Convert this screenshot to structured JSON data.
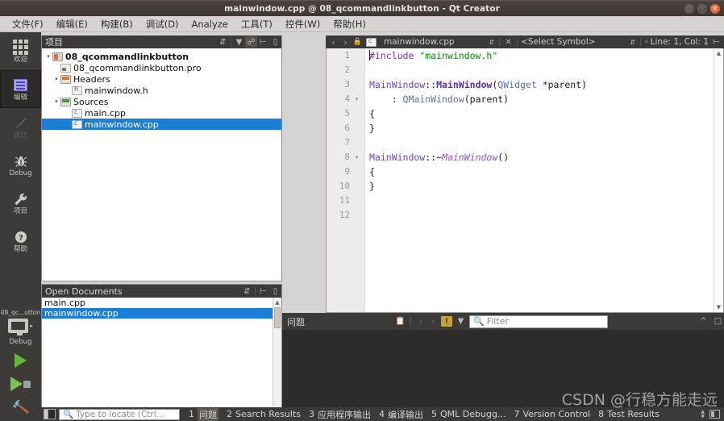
{
  "window": {
    "title": "mainwindow.cpp @ 08_qcommandlinkbutton - Qt Creator",
    "controls": {
      "minimize": "–",
      "maximize": "□",
      "close": "×"
    }
  },
  "menubar": [
    {
      "label": "文件(F)"
    },
    {
      "label": "编辑(E)"
    },
    {
      "label": "构建(B)"
    },
    {
      "label": "调试(D)"
    },
    {
      "label": "Analyze"
    },
    {
      "label": "工具(T)"
    },
    {
      "label": "控件(W)"
    },
    {
      "label": "帮助(H)"
    }
  ],
  "modebar": {
    "modes": [
      {
        "label": "欢迎",
        "icon": "grid-icon",
        "state": "normal"
      },
      {
        "label": "编辑",
        "icon": "editor-icon",
        "state": "selected"
      },
      {
        "label": "设计",
        "icon": "pencil-icon",
        "state": "disabled"
      },
      {
        "label": "Debug",
        "icon": "bug-icon",
        "state": "normal"
      },
      {
        "label": "项目",
        "icon": "wrench-icon",
        "state": "normal"
      },
      {
        "label": "帮助",
        "icon": "question-icon",
        "state": "normal"
      }
    ],
    "kit": {
      "project": "08_qc...utton",
      "build_config": "Debug",
      "run_label": "run-icon",
      "debug_label": "debug-run-icon",
      "build_label": "build-hammer-icon"
    }
  },
  "project_panel": {
    "title": "项目",
    "toolbar": [
      "sync-selector-icon",
      "filter-icon",
      "link-with-editor-icon",
      "split-icon",
      "close-icon"
    ],
    "tree": [
      {
        "label": "08_qcommandlinkbutton",
        "indent": 0,
        "arrow": "▾",
        "icon": "project-icon",
        "bold": true,
        "selected": false
      },
      {
        "label": "08_qcommandlinkbutton.pro",
        "indent": 1,
        "arrow": "",
        "icon": "pro-file-icon",
        "bold": false,
        "selected": false
      },
      {
        "label": "Headers",
        "indent": 1,
        "arrow": "▾",
        "icon": "folder-headers-icon",
        "bold": false,
        "selected": false
      },
      {
        "label": "mainwindow.h",
        "indent": 2,
        "arrow": "",
        "icon": "h-file-icon",
        "bold": false,
        "selected": false
      },
      {
        "label": "Sources",
        "indent": 1,
        "arrow": "▾",
        "icon": "folder-sources-icon",
        "bold": false,
        "selected": false
      },
      {
        "label": "main.cpp",
        "indent": 2,
        "arrow": "",
        "icon": "cpp-file-icon",
        "bold": false,
        "selected": false
      },
      {
        "label": "mainwindow.cpp",
        "indent": 2,
        "arrow": "",
        "icon": "cpp-file-icon",
        "bold": false,
        "selected": true
      }
    ]
  },
  "open_documents": {
    "title": "Open Documents",
    "toolbar": [
      "sync-selector-icon",
      "split-icon",
      "close-icon"
    ],
    "items": [
      {
        "label": "main.cpp",
        "selected": false
      },
      {
        "label": "mainwindow.cpp",
        "selected": true
      }
    ]
  },
  "editor": {
    "toolbar": {
      "back": "‹",
      "forward": "›",
      "lock": "lock-icon",
      "file_icon": "cpp-file-icon",
      "filename": "mainwindow.cpp",
      "symbol_selector": "<Select Symbol>",
      "cursor_position": "Line: 1, Col: 1",
      "split_icon": "split-icon"
    },
    "lines": [
      {
        "n": "1",
        "fold": "",
        "tokens": [
          {
            "t": "#include ",
            "c": "k-pre"
          },
          {
            "t": "\"mainwindow.h\"",
            "c": "k-str"
          }
        ],
        "caret": true
      },
      {
        "n": "2",
        "fold": "",
        "tokens": []
      },
      {
        "n": "3",
        "fold": "",
        "tokens": [
          {
            "t": "MainWindow",
            "c": "k-cls"
          },
          {
            "t": "::",
            "c": "k-pln"
          },
          {
            "t": "MainWindow",
            "c": "k-clsb"
          },
          {
            "t": "(",
            "c": "k-pln"
          },
          {
            "t": "QWidget",
            "c": "k-typ"
          },
          {
            "t": " *parent)",
            "c": "k-pln"
          }
        ]
      },
      {
        "n": "4",
        "fold": "▾",
        "tokens": [
          {
            "t": "    : ",
            "c": "k-pln"
          },
          {
            "t": "QMainWindow",
            "c": "k-typ"
          },
          {
            "t": "(parent)",
            "c": "k-pln"
          }
        ]
      },
      {
        "n": "5",
        "fold": "",
        "tokens": [
          {
            "t": "{",
            "c": "k-pln"
          }
        ]
      },
      {
        "n": "6",
        "fold": "",
        "tokens": [
          {
            "t": "}",
            "c": "k-pln"
          }
        ]
      },
      {
        "n": "7",
        "fold": "",
        "tokens": []
      },
      {
        "n": "8",
        "fold": "▾",
        "tokens": [
          {
            "t": "MainWindow",
            "c": "k-cls"
          },
          {
            "t": "::~",
            "c": "k-pln"
          },
          {
            "t": "MainWindow",
            "c": "k-clsi"
          },
          {
            "t": "()",
            "c": "k-pln"
          }
        ]
      },
      {
        "n": "9",
        "fold": "",
        "tokens": [
          {
            "t": "{",
            "c": "k-pln"
          }
        ]
      },
      {
        "n": "10",
        "fold": "",
        "tokens": [
          {
            "t": "}",
            "c": "k-pln"
          }
        ]
      },
      {
        "n": "11",
        "fold": "",
        "tokens": []
      },
      {
        "n": "12",
        "fold": "",
        "tokens": []
      }
    ]
  },
  "issues_pane": {
    "title": "问题",
    "toolbar": [
      "copy-icon",
      "prev-issue-icon",
      "next-issue-icon",
      "warning-filter-icon",
      "filter-icon"
    ],
    "warning_glyph": "!",
    "filter_placeholder": "Filter",
    "collapse_icon": "^",
    "maximize_icon": "□"
  },
  "statusbar": {
    "sidebar_toggle": "sidebar-toggle-icon",
    "locate_placeholder": "Type to locate (Ctrl...",
    "items": [
      {
        "num": "1",
        "label": "问题",
        "active": true
      },
      {
        "num": "2",
        "label": "Search Results",
        "active": false
      },
      {
        "num": "3",
        "label": "应用程序输出",
        "active": false
      },
      {
        "num": "4",
        "label": "编译输出",
        "active": false
      },
      {
        "num": "5",
        "label": "QML Debugg...",
        "active": false
      },
      {
        "num": "7",
        "label": "Version Control",
        "active": false
      },
      {
        "num": "8",
        "label": "Test Results",
        "active": false
      }
    ]
  },
  "watermark": "CSDN @行稳方能走远",
  "colors": {
    "titlebar": "#413b38",
    "menubar": "#d7d3d0",
    "panel_header": "#3c3a38",
    "selection": "#1a7fd4",
    "modebar": "#3e3a38",
    "close_button": "#d34615",
    "run_green": "#5fb936",
    "warning_yellow": "#c8a13a"
  }
}
